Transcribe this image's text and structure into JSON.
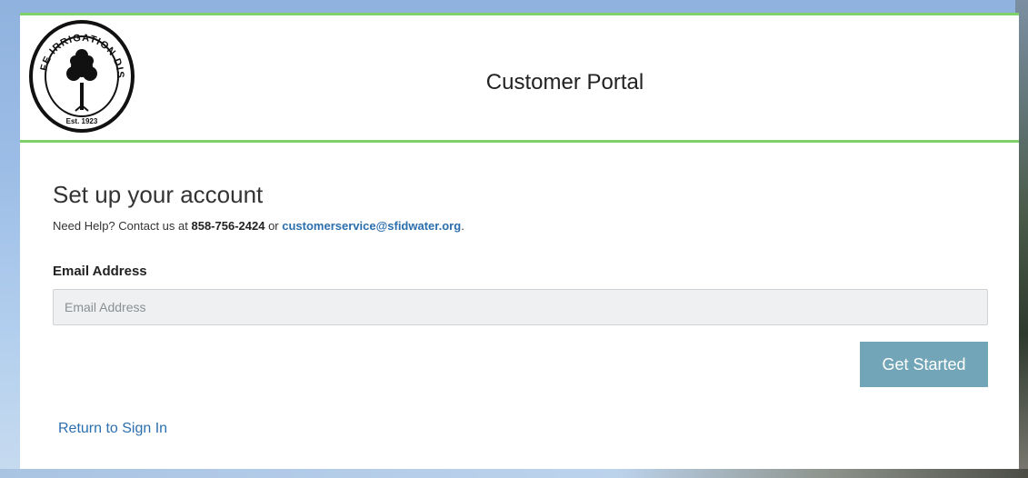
{
  "header": {
    "logo": {
      "arc_text": "SANTA FE IRRIGATION DISTRICT",
      "est_text": "Est. 1923"
    },
    "title": "Customer Portal"
  },
  "main": {
    "heading": "Set up your account",
    "help": {
      "prefix": "Need Help? Contact us at ",
      "phone": "858-756-2424",
      "middle": " or ",
      "email": "customerservice@sfidwater.org",
      "suffix": "."
    },
    "email_field": {
      "label": "Email Address",
      "value": "",
      "placeholder": "Email Address"
    },
    "submit_label": "Get Started",
    "return_link": "Return to Sign In"
  },
  "colors": {
    "accent_green": "#7ed06a",
    "button": "#72a5b7",
    "link": "#2c6fae"
  }
}
